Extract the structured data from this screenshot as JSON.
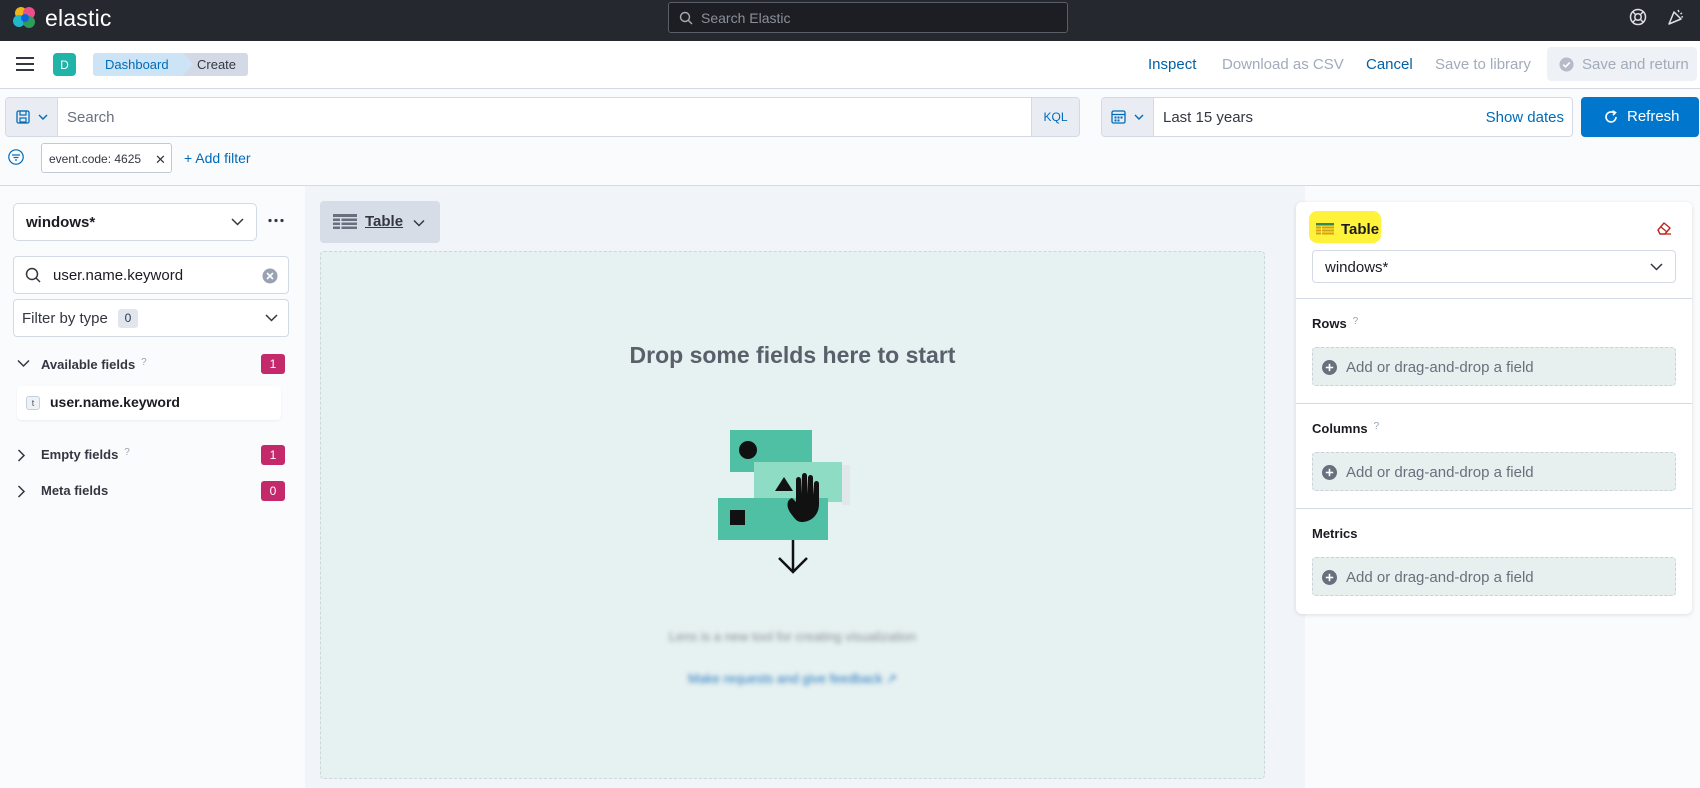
{
  "header": {
    "brand": "elastic",
    "search_placeholder": "Search Elastic",
    "icons": [
      "elastic-logo",
      "help-icon",
      "newsfeed-icon"
    ]
  },
  "subbar": {
    "avatar_letter": "D",
    "breadcrumbs": [
      "Dashboard",
      "Create"
    ],
    "actions": {
      "inspect": "Inspect",
      "download_csv": "Download as CSV",
      "cancel": "Cancel",
      "save_library": "Save to library",
      "save_return": "Save and return"
    }
  },
  "querybar": {
    "placeholder": "Search",
    "language": "KQL",
    "date_range": "Last 15 years",
    "show_dates": "Show dates",
    "refresh": "Refresh"
  },
  "filters": {
    "pills": [
      "event.code: 4625"
    ],
    "add_filter": "+ Add filter"
  },
  "left_panel": {
    "index_pattern": "windows*",
    "field_search_value": "user.name.keyword",
    "filter_by_type": "Filter by type",
    "filter_by_type_count": "0",
    "sections": [
      {
        "label": "Available fields",
        "count": "1",
        "expanded": true
      },
      {
        "label": "Empty fields",
        "count": "1",
        "expanded": false
      },
      {
        "label": "Meta fields",
        "count": "0",
        "expanded": false
      }
    ],
    "fields": [
      {
        "type_token": "t",
        "name": "user.name.keyword"
      }
    ],
    "help_mark": "?"
  },
  "workspace": {
    "viz_type": "Table",
    "dropzone_title": "Drop some fields here to start"
  },
  "right_panel": {
    "viz_type": "Table",
    "index_pattern": "windows*",
    "dimensions": [
      {
        "label": "Rows",
        "placeholder": "Add or drag-and-drop a field"
      },
      {
        "label": "Columns",
        "placeholder": "Add or drag-and-drop a field"
      },
      {
        "label": "Metrics",
        "placeholder": "Add or drag-and-drop a field"
      }
    ]
  },
  "colors": {
    "header_bg": "#25282f",
    "primary": "#0077cc",
    "link": "#006bb8",
    "badge": "#c42a6b",
    "highlight": "#fff23a",
    "dropzone": "#e6f1f1"
  }
}
